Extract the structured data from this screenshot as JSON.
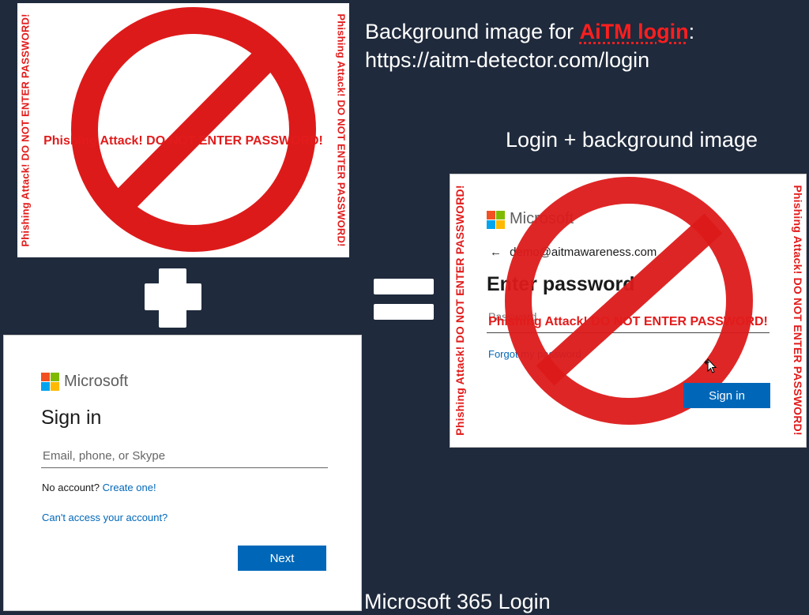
{
  "heading": {
    "prefix": "Background image for ",
    "highlight": "AiTM login",
    "suffix": ":",
    "url": "https://aitm-detector.com/login"
  },
  "labels": {
    "login_plus_background": "Login + background image",
    "microsoft_365_login": "Microsoft 365 Login"
  },
  "warning": {
    "text": "Phishing Attack! DO NOT ENTER PASSWORD!",
    "color": "#e21b1b"
  },
  "signin": {
    "brand": "Microsoft",
    "title": "Sign in",
    "email_placeholder": "Email, phone, or Skype",
    "no_account_text": "No account?",
    "create_link": "Create one!",
    "cant_access_link": "Can't access your account?",
    "next_button": "Next"
  },
  "password_page": {
    "brand": "Microsoft",
    "back_arrow": "←",
    "email": "demo@aitmawareness.com",
    "title": "Enter password",
    "password_placeholder": "Password",
    "forgot_link": "Forgot my password",
    "signin_button": "Sign in"
  },
  "colors": {
    "background": "#1f2a3c",
    "ms_red": "#f25022",
    "ms_green": "#7fba00",
    "ms_blue": "#00a4ef",
    "ms_yellow": "#ffb900",
    "accent_blue": "#0067b8"
  },
  "icons": {
    "prohibition": "prohibition-sign-icon",
    "cursor": "move-cursor-icon",
    "back": "back-arrow-icon"
  }
}
